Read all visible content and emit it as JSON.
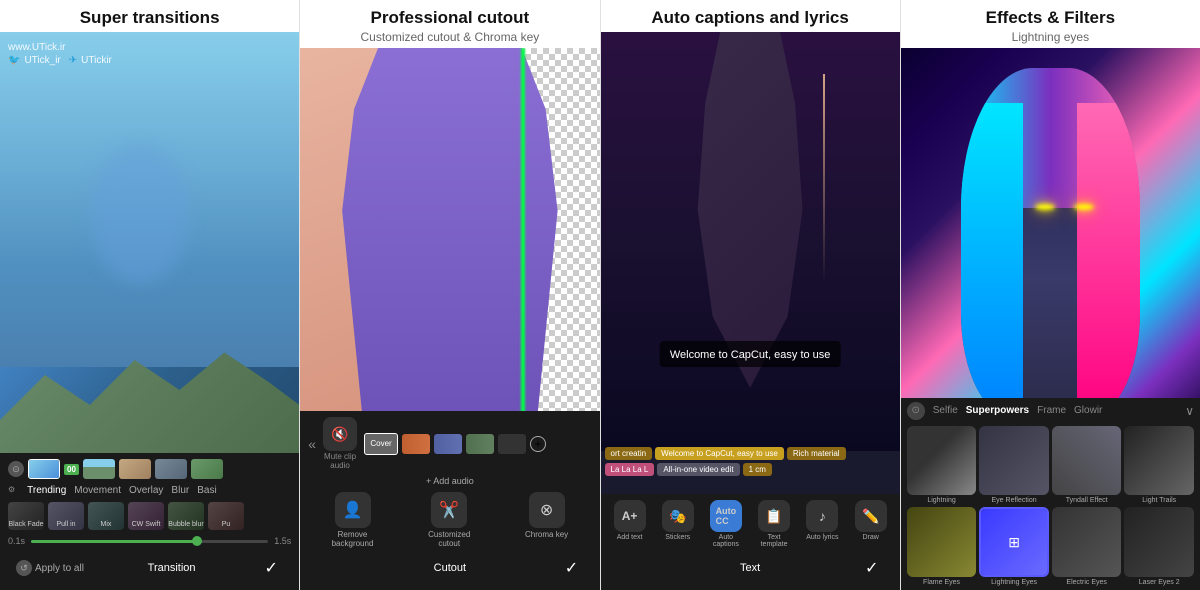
{
  "panels": [
    {
      "id": "super-transitions",
      "title": "Super transitions",
      "subtitle": "",
      "watermark": "www.UTick.ir",
      "social": {
        "twitter": "UTick_ir",
        "telegram": "UTickir"
      },
      "filters": [
        "Trending",
        "Movement",
        "Overlay",
        "Blur",
        "Basi"
      ],
      "filterThumbs": [
        {
          "name": "Black Fade"
        },
        {
          "name": "Pull in"
        },
        {
          "name": "Mix"
        },
        {
          "name": "CW Swift"
        },
        {
          "name": "Bubble blur"
        },
        {
          "name": "Pu"
        }
      ],
      "sliderMin": "0.1s",
      "sliderMax": "1.5s",
      "bottomLabel": "Transition"
    },
    {
      "id": "professional-cutout",
      "title": "Professional cutout",
      "subtitle": "Customized cutout & Chroma key",
      "tools": [
        {
          "icon": "👤",
          "label": "Remove\nbackground"
        },
        {
          "icon": "✂️",
          "label": "Customized\ncutout"
        },
        {
          "icon": "🎨",
          "label": "Chroma key"
        }
      ],
      "bottomLabel": "Cutout",
      "addAudioLabel": "+ Add audio"
    },
    {
      "id": "auto-captions",
      "title": "Auto captions and lyrics",
      "subtitle": "",
      "caption": "Welcome to CapCut, easy to use",
      "tags": [
        {
          "text": "ort creatin",
          "style": "brown"
        },
        {
          "text": "Welcome to CapCut, easy to use",
          "style": "yellow"
        },
        {
          "text": "Rich material",
          "style": "brown"
        },
        {
          "text": "La La La L",
          "style": "pink"
        },
        {
          "text": "All-in-one video edit",
          "style": "gray"
        },
        {
          "text": "1 cm",
          "style": "brown"
        }
      ],
      "textTools": [
        {
          "icon": "A+",
          "label": "Add text"
        },
        {
          "icon": "🎭",
          "label": "Stickers"
        },
        {
          "icon": "CC",
          "label": "Auto\ncaptions",
          "highlighted": true
        },
        {
          "icon": "📄",
          "label": "Text\ntemplate"
        },
        {
          "icon": "♪",
          "label": "Auto lyrics"
        },
        {
          "icon": "✏️",
          "label": "Draw"
        }
      ],
      "bottomLabel": "Text"
    },
    {
      "id": "effects-filters",
      "title": "Effects & Filters",
      "subtitle": "Lightning eyes",
      "tabs": [
        "Selfie",
        "Superpowers",
        "Frame",
        "Glowir"
      ],
      "activeTab": "Superpowers",
      "effects": [
        {
          "name": "Lightning",
          "style": "lightning"
        },
        {
          "name": "Eye Reflection",
          "style": "eye-ref"
        },
        {
          "name": "Tyndall Effect",
          "style": "tyndall"
        },
        {
          "name": "Light Trails",
          "style": "light-trail"
        },
        {
          "name": "Flame Eyes",
          "style": "flame"
        },
        {
          "name": "Lightning Eyes",
          "style": "lightning-eyes",
          "highlighted": true
        },
        {
          "name": "Electric Eyes",
          "style": "electric"
        },
        {
          "name": "Laser Eyes 2",
          "style": "laser"
        }
      ]
    }
  ],
  "icons": {
    "checkmark": "✓",
    "settings": "⚙",
    "back": "«",
    "add": "+",
    "twitter": "🐦",
    "telegram": "✈"
  }
}
